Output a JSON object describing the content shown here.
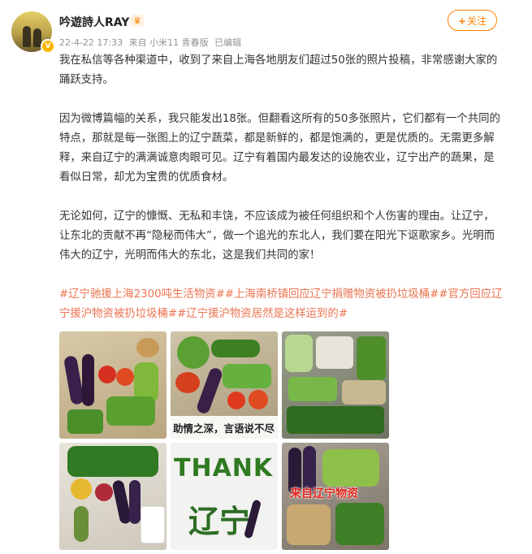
{
  "user": {
    "name": "吟遊詩人RAY",
    "date": "22-4-22 17:33",
    "source": "来自 小米11 青春版",
    "edited": "已编辑",
    "follow_label": "关注"
  },
  "post": {
    "paragraphs": [
      "我在私信等各种渠道中，收到了来自上海各地朋友们超过50张的照片投稿，非常感谢大家的踊跃支持。",
      "因为微博篇幅的关系，我只能发出18张。但翻看这所有的50多张照片，它们都有一个共同的特点，那就是每一张图上的辽宁蔬菜，都是新鲜的，都是饱满的，更是优质的。无需更多解释，来自辽宁的满满诚意肉眼可见。辽宁有着国内最发达的设施农业，辽宁出产的蔬果，是看似日常，却尤为宝贵的优质食材。",
      "无论如何，辽宁的慷慨、无私和丰饶，不应该成为被任何组织和个人伤害的理由。让辽宁，让东北的贡献不再“隐秘而伟大”，做一个追光的东北人，我们要在阳光下讴歌家乡。光明而伟大的辽宁，光明而伟大的东北，这是我们共同的家！"
    ],
    "hashtags": "#辽宁驰援上海2300吨生活物资##上海南桥镇回应辽宁捐赠物资被扔垃圾桶##官方回应辽宁援沪物资被扔垃圾桶##辽宁援沪物资居然是这样运到的#"
  },
  "photos": {
    "p2_text": "助情之深，言语说不尽",
    "p5_text": "THANK",
    "p5_text2": "辽宁",
    "p6_text": "来自辽宁物资"
  },
  "colors": {
    "accent": "#ff8200",
    "hashtag": "#eb7350",
    "meta": "#939393"
  }
}
